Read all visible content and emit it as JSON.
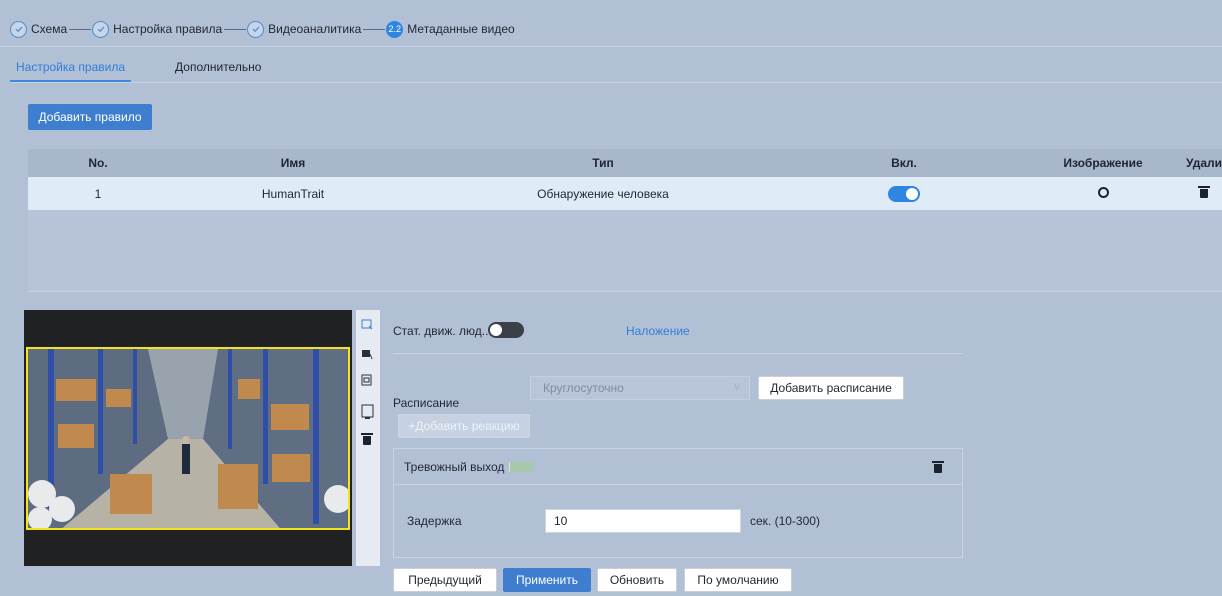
{
  "stepper": {
    "steps": [
      {
        "label": "Схема"
      },
      {
        "label": "Настройка правила"
      },
      {
        "label": "Видеоаналитика"
      },
      {
        "label": "Метаданные видео",
        "badge": "2.2"
      }
    ]
  },
  "tabs": [
    {
      "label": "Настройка правила",
      "active": true
    },
    {
      "label": "Дополнительно",
      "active": false
    }
  ],
  "add_rule_label": "Добавить правило",
  "table": {
    "headers": [
      "No.",
      "Имя",
      "Тип",
      "Вкл.",
      "Изображение",
      "Удалить"
    ],
    "rows": [
      {
        "no": "1",
        "name": "HumanTrait",
        "type": "Обнаружение человека",
        "enabled": true
      }
    ]
  },
  "config": {
    "stat_label": "Стат. движ. люд...",
    "stat_enabled": false,
    "overlay_link": "Наложение",
    "schedule_label": "Расписание",
    "schedule_value": "Круглосуточно",
    "add_schedule_label": "Добавить расписание",
    "add_reaction_label": "+Добавить реакцию",
    "alarm_out_label": "Тревожный выход",
    "delay_label": "Задержка",
    "delay_value": "10",
    "delay_unit": "сек. (10-300)"
  },
  "footer": {
    "prev_label": "Предыдущий",
    "apply_label": "Применить",
    "refresh_label": "Обновить",
    "default_label": "По умолчанию"
  },
  "colors": {
    "accent": "#3f7ecf",
    "background": "#b2c0d6",
    "zone_border": "#f3e21c"
  }
}
